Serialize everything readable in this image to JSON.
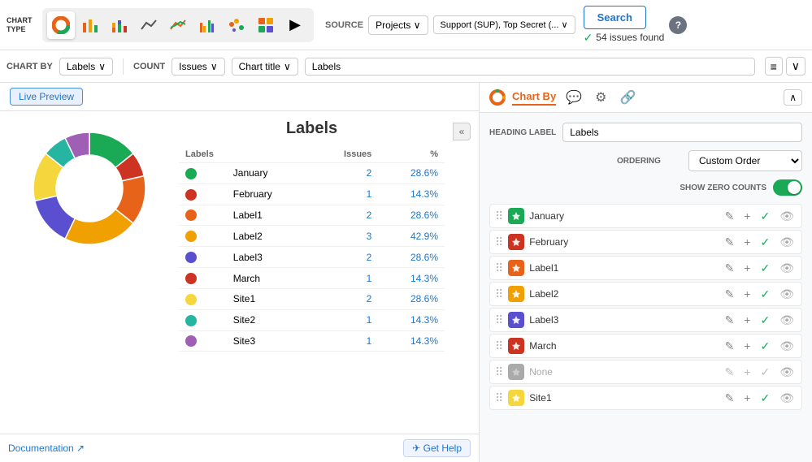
{
  "topBar": {
    "chartTypeLabel": "CHART\nTYPE",
    "sourceLabel": "SOURCE",
    "projectsDropdown": "Projects ∨",
    "supportDropdown": "Support (SUP), Top Secret (... ∨",
    "searchBtn": "Search",
    "helpBtn": "?",
    "issuesCount": "54 issues found"
  },
  "secondBar": {
    "chartByLabel": "CHART BY",
    "chartByValue": "Labels",
    "countLabel": "COUNT",
    "issuesDropdown": "Issues",
    "chartTitleLabel": "Chart title",
    "labelsValue": "Labels"
  },
  "leftPanel": {
    "livePreviewBtn": "Live Preview",
    "chartTitle": "Labels",
    "tableHeaders": [
      "Labels",
      "Issues",
      "%"
    ],
    "collapseBtn": "«",
    "rows": [
      {
        "color": "#1aaa55",
        "label": "January",
        "issues": 2,
        "percent": "28.6%"
      },
      {
        "color": "#cc3322",
        "label": "February",
        "issues": 1,
        "percent": "14.3%"
      },
      {
        "color": "#e8631a",
        "label": "Label1",
        "issues": 2,
        "percent": "28.6%"
      },
      {
        "color": "#f0a000",
        "label": "Label2",
        "issues": 3,
        "percent": "42.9%"
      },
      {
        "color": "#5a4fcf",
        "label": "Label3",
        "issues": 2,
        "percent": "28.6%"
      },
      {
        "color": "#cc3322",
        "label": "March",
        "issues": 1,
        "percent": "14.3%"
      },
      {
        "color": "#f5d63d",
        "label": "Site1",
        "issues": 2,
        "percent": "28.6%"
      },
      {
        "color": "#26b5a0",
        "label": "Site2",
        "issues": 1,
        "percent": "14.3%"
      },
      {
        "color": "#9e5fb5",
        "label": "Site3",
        "issues": 1,
        "percent": "14.3%"
      }
    ]
  },
  "rightPanel": {
    "title": "Chart By",
    "headingLabel": "HEADING LABEL",
    "headingValue": "Labels",
    "orderingLabel": "ORDERING",
    "orderingValue": "Custom Order",
    "showZeroLabel": "SHOW ZERO COUNTS",
    "labels": [
      {
        "name": "January",
        "color": "#1aaa55",
        "grayed": false
      },
      {
        "name": "February",
        "color": "#cc3322",
        "grayed": false
      },
      {
        "name": "Label1",
        "color": "#e8631a",
        "grayed": false
      },
      {
        "name": "Label2",
        "color": "#f0a000",
        "grayed": false
      },
      {
        "name": "Label3",
        "color": "#5a4fcf",
        "grayed": false
      },
      {
        "name": "March",
        "color": "#cc3322",
        "grayed": false
      },
      {
        "name": "None",
        "color": "#aaa",
        "grayed": true
      },
      {
        "name": "Site1",
        "color": "#f5d63d",
        "grayed": false
      }
    ]
  },
  "bottomBar": {
    "docLink": "Documentation ↗",
    "getHelp": "✈ Get Help"
  },
  "donut": {
    "segments": [
      {
        "color": "#1aaa55",
        "value": 28.6
      },
      {
        "color": "#cc3322",
        "value": 14.3
      },
      {
        "color": "#e8631a",
        "value": 28.6
      },
      {
        "color": "#f0a000",
        "value": 42.9
      },
      {
        "color": "#5a4fcf",
        "value": 28.6
      },
      {
        "color": "#f5d63d",
        "value": 28.6
      },
      {
        "color": "#26b5a0",
        "value": 14.3
      },
      {
        "color": "#9e5fb5",
        "value": 14.3
      }
    ]
  }
}
